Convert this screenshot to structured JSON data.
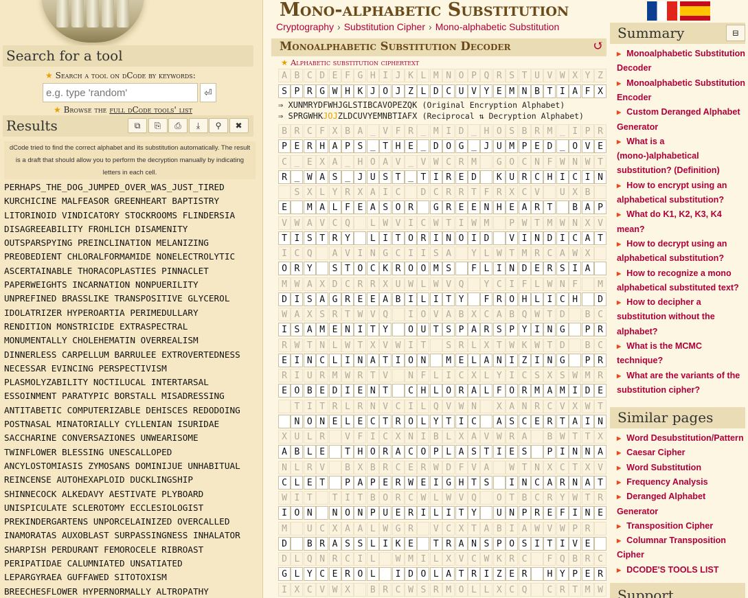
{
  "left": {
    "logo_name": "cipher-cylinder-logo",
    "search": {
      "title": "Search for a tool",
      "label": "Search a tool on dCode by keywords:",
      "placeholder": "e.g. type 'random'",
      "go_icon": "enter-icon",
      "browse_prefix": "Browse the ",
      "browse_link": "full dCode tools' list"
    },
    "results": {
      "title": "Results",
      "buttons": [
        "copy-icon",
        "save-icon",
        "print-icon",
        "download-icon",
        "pin-icon",
        "close-icon"
      ],
      "note": "dCode tried to find the correct alphabet and its substitution automatically. The result is a draft that should allow you to perform the decryption manually by indicating letters in each cell.",
      "lines": [
        "PERHAPS_THE_DOG_JUMPED_OVER_WAS_JUST_TIRED",
        "KURCHICINE MALFEASOR GREENHEART BAPTISTRY",
        "LITORINOID VINDICATORY STOCKROOMS FLINDERSIA",
        "DISAGREEABILITY FROHLICH DISAMENITY",
        "OUTSPARSPYING PREINCLINATION MELANIZING",
        "PREOBEDIENT CHLORALFORMAMIDE NONELECTROLYTIC",
        "ASCERTAINABLE THORACOPLASTIES PINNACLET",
        "PAPERWEIGHTS INCARNATION NONPUERILITY",
        "UNPREFINED BRASSLIKE TRANSPOSITIVE GLYCEROL",
        "IDOLATRIZER HYPEROARTIA PERIMEDULLARY",
        "RENDITION MONSTRICIDE EXTRASPECTRAL",
        "MONUMENTALLY CHOLEHEMATIN OVERREALISM",
        "DINNERLESS CARPELLUM BARRULEE EXTROVERTEDNESS",
        "NECESSAR EVINCING PERSPECTIVISM",
        "PLASMOLYZABILITY NOCTILUCAL INTERTARSAL",
        "ESSOINMENT PARATYPIC BORSTALL MISADRESSING",
        "ANTITABETIC COMPUTERIZABLE DEHISCES REDODOING",
        "POSTNASAL MINATORIALLY CYLLENIAN ISURIDAE",
        "SACCHARINE CONVERSAZIONES UNWEARISOME",
        "TWINFLOWER BLESSING UNESCALLOPED",
        "ANCYLOSTOMIASIS ZYMOSANS DOMINIJUE UNHABITUAL",
        "REINCENSE AUTOHEXAPLOID DUCKLINGSHIP",
        "SHINNECOCK ALKEDAVY AESTIVATE PLYBOARD",
        "UNISPICULATE SCLEROTOMY ECCLESIOLOGIST",
        "PREKINDERGARTENS UNPORCELAINIZED OVERCALLED",
        "INAMORATAS AUXOBLAST SURPASSINGNESS INHALATOR",
        "SHARPISH PERDURANT FEMOROCELE RIBROAST",
        "PERIPATIDAE CALUMNIATED UNSATIATED",
        "LEPARGYRAEA GUFFAWED SITOTOXISM",
        "BREECHESFLOWER HYPERNORMALLY ALTROPATHY"
      ]
    }
  },
  "main": {
    "title": "Mono-alphabetic Substitution",
    "breadcrumb": [
      "Cryptography",
      "Substitution Cipher",
      "Mono-alphabetic Substitution"
    ],
    "decoder_title": "Monoalphabetic Substitution Decoder",
    "reload_icon": "reload-icon",
    "ciphertext_label": "Alphabetic substitution ciphertext",
    "plain_alphabet": "ABCDEFGHIJKLMNOPQRSTUVWXYZ",
    "sub_alphabet": "SPRGWHKJOJZLDCUVYEMNBTIAFX",
    "orig_line": {
      "arrow": "⇒",
      "alphabet": "XUNMRYDFWHJGLSTIBCAVOPEZQK",
      "note": "(Original Encryption Alphabet)"
    },
    "recip_line": {
      "arrow": "⇒",
      "alphabet": "SPRGWHK",
      "alphabet_hl": "JOJ",
      "alphabet_rest": "ZLDCUVYEMNBTIAFX",
      "note": "(Reciprocal ⇅ Decryption Alphabet)"
    },
    "grid_rows": [
      [
        "BRCFXBA_VFR_MID_HOSBRM_IPR",
        "PERHAPS_THE_DOG_JUMPED_OVE"
      ],
      [
        "C_EXA_HOAV_VWCRM GOCNFWNWT",
        "R_WAS_JUST_TIRED KURCHICIN"
      ],
      [
        " SXLYRXAIC DCRRTFRXCV UXB",
        "E MALFEASOR GREENHEART BAP"
      ],
      [
        "VWAVCQ LWVICWTIWM PWTMWNXV",
        "TISTRY LITORINOID VINDICAT"
      ],
      [
        "ICQ AVINGCIISA YLWTMRCAWX",
        "ORY STOCKROOMS FLINDERSIA"
      ],
      [
        "MWAXDCRRXUWLWVQ YCIFLWNF M",
        "DISAGREEABILITY FROHLICH D"
      ],
      [
        "WAXSRTWVQ IOVABXCABQWTD BC",
        "ISAMENITY OUTSPARSPYING PR"
      ],
      [
        "RWTNLWTXVWIT SRLXTWKWTD BC",
        "EINCLINATION MELANIZING PR"
      ],
      [
        "RIURMWRTV NFLICXLYICSXSWMR",
        "EOBEDIENT CHLORALFORMAMIDE"
      ],
      [
        " TITRLRNVCILQVWN XANRCVXWT",
        " NONELECTROLYTIC ASCERTAIN"
      ],
      [
        "XULR VFICXNIBLXAVWRA BWTTX",
        "ABLE THORACOPLASTIES PINNA"
      ],
      [
        "NLRV BXBRCERWDFVA WTNXCTXV",
        "CLET PAPERWEIGHTS INCARNAT"
      ],
      [
        "WIT TITBORCWLWVQ OTBCRYWTR",
        "ION NONPUERILITY UNPREFINE"
      ],
      [
        "M UCXAALWGR VCXTABIAWVWPR",
        "D BRASSLIKE TRANSPOSITIVE"
      ],
      [
        "DLQNRCIL WMILXVCWKRC FQBRC",
        "GLYCEROL IDOLATRIZER HYPER"
      ],
      [
        "IXCVWX BRCWSRMOLLXCQ CRTMW",
        ""
      ]
    ]
  },
  "right": {
    "flags": [
      "fr-flag",
      "es-flag"
    ],
    "colors": {
      "link": "#b0003a",
      "bullet": "#e74a1a",
      "header_bg": "#eadcb4"
    },
    "summary": {
      "title": "Summary",
      "collapse_icon": "collapse-icon",
      "links": [
        "Monoalphabetic Substitution Decoder",
        "Monoalphabetic Substitution Encoder",
        "Custom Deranged Alphabet Generator",
        "What is a (mono-)alphabetical substitution? (Definition)",
        "How to encrypt using an alphabetical substitution?",
        "What do K1, K2, K3, K4 mean?",
        "How to decrypt using an alphabetical substitution?",
        "How to recognize a mono alphabetical substituted text?",
        "How to decipher a substitution without the alphabet?",
        "What is the MCMC technique?",
        "What are the variants of the substitution cipher?"
      ]
    },
    "similar": {
      "title": "Similar pages",
      "links": [
        "Word Desubstitution/Pattern",
        "Caesar Cipher",
        "Word Substitution",
        "Frequency Analysis",
        "Deranged Alphabet Generator",
        "Transposition Cipher",
        "Columnar Transposition Cipher",
        "DCODE'S TOOLS LIST"
      ]
    },
    "support": {
      "title": "Support"
    }
  }
}
